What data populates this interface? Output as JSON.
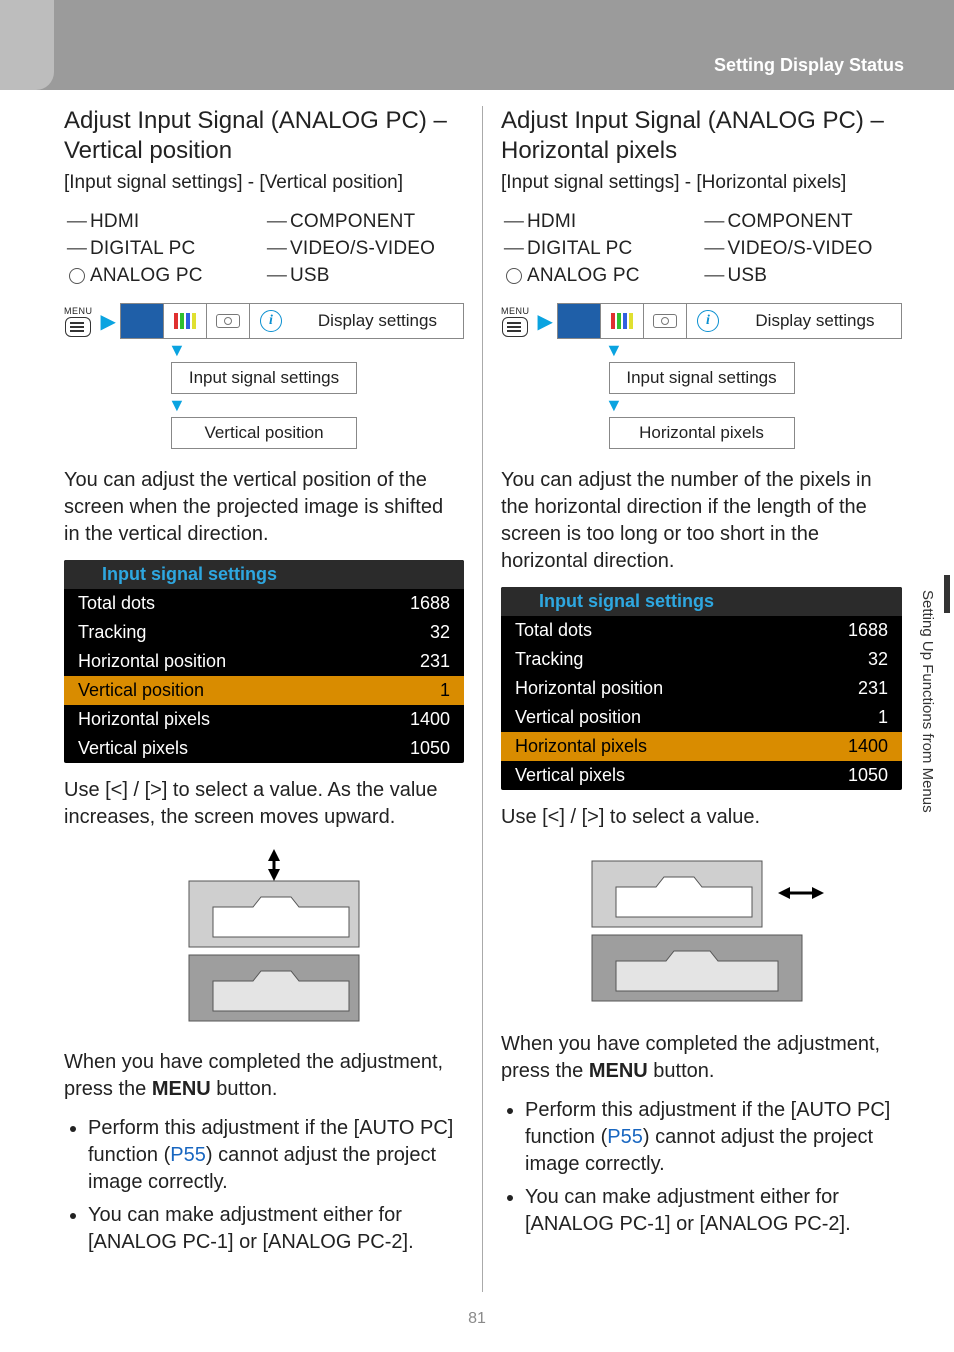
{
  "header": {
    "title": "Setting Display Status"
  },
  "side_text": "Setting Up Functions from Menus",
  "page_number": "81",
  "inputs": {
    "hdmi": "HDMI",
    "component": "COMPONENT",
    "digital_pc": "DIGITAL PC",
    "video": "VIDEO/S-VIDEO",
    "analog_pc": "ANALOG PC",
    "usb": "USB"
  },
  "nav": {
    "menu_label": "MENU",
    "display_settings": "Display settings",
    "input_signal_settings": "Input signal settings"
  },
  "left": {
    "heading": "Adjust Input Signal (ANALOG PC) – Vertical position",
    "path": "[Input signal settings] - [Vertical position]",
    "nav_leaf": "Vertical position",
    "desc": "You can adjust the vertical position of the screen when the projected image is shifted in the vertical direction.",
    "osd_title": "Input signal settings",
    "osd": [
      {
        "label": "Total dots",
        "value": "1688",
        "hl": false
      },
      {
        "label": "Tracking",
        "value": "32",
        "hl": false
      },
      {
        "label": "Horizontal position",
        "value": "231",
        "hl": false
      },
      {
        "label": "Vertical position",
        "value": "1",
        "hl": true
      },
      {
        "label": "Horizontal pixels",
        "value": "1400",
        "hl": false
      },
      {
        "label": "Vertical pixels",
        "value": "1050",
        "hl": false
      }
    ],
    "hint": "Use [<] / [>] to select a value. As the value increases, the screen moves upward.",
    "done_a": "When you have completed the adjustment, press the ",
    "done_b": "MENU",
    "done_c": " button.",
    "b1a": "Perform this adjustment if the [AUTO PC] function (",
    "b1b": "P55",
    "b1c": ") cannot adjust the project image correctly.",
    "b2": "You can make adjustment either for [ANALOG PC-1] or [ANALOG PC-2]."
  },
  "right": {
    "heading": "Adjust Input Signal (ANALOG PC) – Horizontal pixels",
    "path": "[Input signal settings] - [Horizontal pixels]",
    "nav_leaf": "Horizontal pixels",
    "desc": "You can adjust the number of the pixels in the horizontal direction if the length of the screen is too long or too short in the horizontal direction.",
    "osd_title": "Input signal settings",
    "osd": [
      {
        "label": "Total dots",
        "value": "1688",
        "hl": false
      },
      {
        "label": "Tracking",
        "value": "32",
        "hl": false
      },
      {
        "label": "Horizontal position",
        "value": "231",
        "hl": false
      },
      {
        "label": "Vertical position",
        "value": "1",
        "hl": false
      },
      {
        "label": "Horizontal pixels",
        "value": "1400",
        "hl": true
      },
      {
        "label": "Vertical pixels",
        "value": "1050",
        "hl": false
      }
    ],
    "hint": "Use [<] / [>] to select a value.",
    "done_a": "When you have completed the adjustment, press the ",
    "done_b": "MENU",
    "done_c": " button.",
    "b1a": "Perform this adjustment if the [AUTO PC] function (",
    "b1b": "P55",
    "b1c": ") cannot adjust the project image correctly.",
    "b2": "You can make adjustment either for [ANALOG PC-1] or [ANALOG PC-2]."
  }
}
